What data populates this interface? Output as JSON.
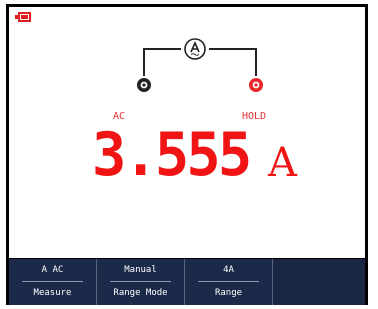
{
  "status": {
    "battery_icon": "battery-icon",
    "mode_label": "AC",
    "hold_label": "HOLD"
  },
  "display": {
    "reading": "3.555",
    "unit": "A",
    "probe_icon": "current-probe-icon",
    "terminal_left_icon": "com-terminal-icon",
    "terminal_right_icon": "amp-terminal-icon"
  },
  "softkeys": [
    {
      "top": "A AC",
      "bottom": "Measure"
    },
    {
      "top": "Manual",
      "bottom": "Range Mode"
    },
    {
      "top": "4A",
      "bottom": "Range"
    }
  ],
  "colors": {
    "reading": "#f01414",
    "softkey_bg": "#1c2a4a",
    "frame": "#000000"
  }
}
